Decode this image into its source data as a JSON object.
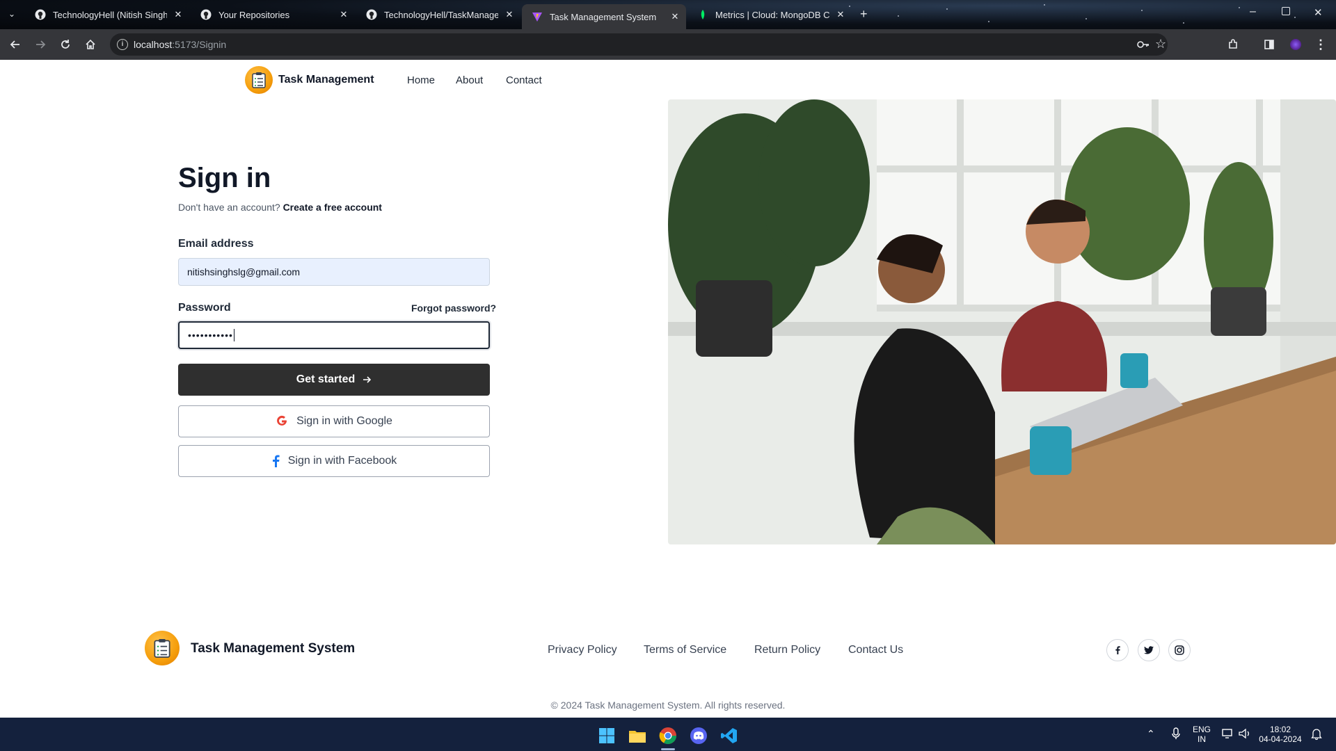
{
  "browser": {
    "tabs": [
      {
        "title": "TechnologyHell (Nitish Singh)",
        "icon": "github-icon"
      },
      {
        "title": "Your Repositories",
        "icon": "github-icon"
      },
      {
        "title": "TechnologyHell/TaskManageme",
        "icon": "github-icon"
      },
      {
        "title": "Task Management System",
        "icon": "vite-icon",
        "active": true
      },
      {
        "title": "Metrics | Cloud: MongoDB Clou",
        "icon": "mongodb-leaf-icon"
      }
    ],
    "url_host": "localhost",
    "url_path": ":5173/Signin"
  },
  "header": {
    "brand": "Task Management",
    "nav": [
      "Home",
      "About",
      "Contact"
    ]
  },
  "signin": {
    "title": "Sign in",
    "no_account": "Don't have an account?",
    "create_account": "Create a free account",
    "email_label": "Email address",
    "email_value": "nitishsinghslg@gmail.com",
    "password_label": "Password",
    "forgot_password": "Forgot password?",
    "password_value": "•••••••••••",
    "get_started": "Get started",
    "google": "Sign in with Google",
    "facebook": "Sign in with Facebook"
  },
  "footer": {
    "brand": "Task Management System",
    "links": [
      "Privacy Policy",
      "Terms of Service",
      "Return Policy",
      "Contact Us"
    ],
    "social": [
      "facebook-icon",
      "twitter-icon",
      "instagram-icon"
    ],
    "copyright": "© 2024 Task Management System. All rights reserved."
  },
  "taskbar": {
    "lang_top": "ENG",
    "lang_bottom": "IN",
    "time": "18:02",
    "date": "04-04-2024"
  },
  "colors": {
    "accent_dark": "#2f2f2f",
    "logo_orange": "#f59e0b",
    "autofill_blue": "#e8f0fe",
    "google_red": "#ea4335",
    "facebook_blue": "#1877f2"
  }
}
